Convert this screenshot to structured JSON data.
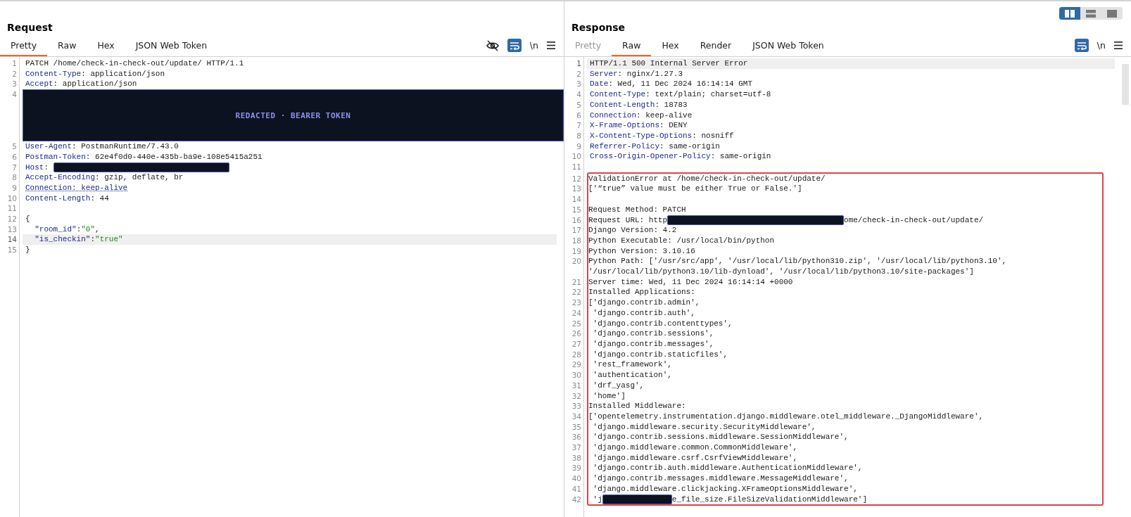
{
  "layout_buttons": [
    {
      "kind": "columns",
      "selected": true
    },
    {
      "kind": "rows",
      "selected": false
    },
    {
      "kind": "single",
      "selected": false
    }
  ],
  "panes": [
    {
      "title": "Request",
      "tabs": [
        {
          "label": "Pretty",
          "selected": true,
          "disabled": false
        },
        {
          "label": "Raw",
          "selected": false,
          "disabled": false
        },
        {
          "label": "Hex",
          "selected": false,
          "disabled": false
        },
        {
          "label": "JSON Web Token",
          "selected": false,
          "disabled": false
        }
      ],
      "tools": [
        {
          "kind": "hide"
        },
        {
          "kind": "wrap",
          "on": true
        },
        {
          "kind": "newline",
          "label": "\\n"
        },
        {
          "kind": "menu"
        }
      ],
      "lines": [
        {
          "number": "1",
          "selected": false,
          "boxed": false,
          "segments": [
            {
              "kind": "text",
              "text": "PATCH /home/check-in-check-out/update/ HTTP/1.1"
            }
          ]
        },
        {
          "number": "2",
          "selected": false,
          "boxed": false,
          "segments": [
            {
              "kind": "key",
              "text": "Content-Type"
            },
            {
              "kind": "text",
              "text": ": application/json"
            }
          ]
        },
        {
          "number": "3",
          "selected": false,
          "boxed": false,
          "segments": [
            {
              "kind": "key",
              "text": "Accept"
            },
            {
              "kind": "text",
              "text": ": application/json"
            }
          ]
        },
        {
          "number": "4",
          "selected": false,
          "boxed": false,
          "segments": [
            {
              "kind": "banner",
              "text": "REDACTED · BEARER TOKEN"
            }
          ]
        },
        {
          "number": "5",
          "selected": false,
          "boxed": false,
          "segments": [
            {
              "kind": "key",
              "text": "User-Agent"
            },
            {
              "kind": "text",
              "text": ": PostmanRuntime/7.43.0"
            }
          ]
        },
        {
          "number": "6",
          "selected": false,
          "boxed": false,
          "segments": [
            {
              "kind": "key",
              "text": "Postman-Token"
            },
            {
              "kind": "text",
              "text": ": 62e4f0d0-440e-435b-ba9e-108e5415a251"
            }
          ]
        },
        {
          "number": "7",
          "selected": false,
          "boxed": false,
          "segments": [
            {
              "kind": "key",
              "text": "Host"
            },
            {
              "kind": "text",
              "text": ": "
            },
            {
              "kind": "redacted_wide"
            }
          ]
        },
        {
          "number": "8",
          "selected": false,
          "boxed": false,
          "segments": [
            {
              "kind": "key",
              "text": "Accept-Encoding"
            },
            {
              "kind": "text",
              "text": ": gzip, deflate, br"
            }
          ]
        },
        {
          "number": "9",
          "selected": false,
          "boxed": false,
          "segments": [
            {
              "kind": "flagged",
              "text": "Connection: keep-alive"
            }
          ]
        },
        {
          "number": "10",
          "selected": false,
          "boxed": false,
          "segments": [
            {
              "kind": "key",
              "text": "Content-Length"
            },
            {
              "kind": "text",
              "text": ": 44"
            }
          ]
        },
        {
          "number": "11",
          "selected": false,
          "boxed": false
        },
        {
          "number": "12",
          "selected": false,
          "boxed": false,
          "segments": [
            {
              "kind": "text",
              "text": "{"
            }
          ]
        },
        {
          "number": "13",
          "selected": false,
          "boxed": false,
          "segments": [
            {
              "kind": "key",
              "text": "  \"room_id\""
            },
            {
              "kind": "text",
              "text": ":"
            },
            {
              "kind": "string",
              "text": "\"0\""
            },
            {
              "kind": "text",
              "text": ","
            }
          ]
        },
        {
          "number": "14",
          "selected": true,
          "boxed": false,
          "segments": [
            {
              "kind": "key",
              "text": "  \"is_checkin\""
            },
            {
              "kind": "text",
              "text": ":"
            },
            {
              "kind": "string",
              "text": "\"true\""
            }
          ]
        },
        {
          "number": "15",
          "selected": false,
          "boxed": false,
          "segments": [
            {
              "kind": "text",
              "text": "}"
            }
          ]
        }
      ]
    },
    {
      "title": "Response",
      "tabs": [
        {
          "label": "Pretty",
          "selected": false,
          "disabled": true
        },
        {
          "label": "Raw",
          "selected": true,
          "disabled": false
        },
        {
          "label": "Hex",
          "selected": false,
          "disabled": false
        },
        {
          "label": "Render",
          "selected": false,
          "disabled": false
        },
        {
          "label": "JSON Web Token",
          "selected": false,
          "disabled": false
        }
      ],
      "tools": [
        {
          "kind": "wrap",
          "on": true
        },
        {
          "kind": "newline",
          "label": "\\n"
        },
        {
          "kind": "menu"
        }
      ],
      "scrollbar": true,
      "lines": [
        {
          "number": "1",
          "selected": true,
          "boxed": false,
          "segments": [
            {
              "kind": "text",
              "text": "HTTP/1.1 500 Internal Server Error"
            }
          ]
        },
        {
          "number": "2",
          "selected": false,
          "boxed": false,
          "segments": [
            {
              "kind": "key",
              "text": "Server"
            },
            {
              "kind": "text",
              "text": ": nginx/1.27.3"
            }
          ]
        },
        {
          "number": "3",
          "selected": false,
          "boxed": false,
          "segments": [
            {
              "kind": "key",
              "text": "Date"
            },
            {
              "kind": "text",
              "text": ": Wed, 11 Dec 2024 16:14:14 GMT"
            }
          ]
        },
        {
          "number": "4",
          "selected": false,
          "boxed": false,
          "segments": [
            {
              "kind": "key",
              "text": "Content-Type"
            },
            {
              "kind": "text",
              "text": ": text/plain; charset=utf-8"
            }
          ]
        },
        {
          "number": "5",
          "selected": false,
          "boxed": false,
          "segments": [
            {
              "kind": "key",
              "text": "Content-Length"
            },
            {
              "kind": "text",
              "text": ": 18783"
            }
          ]
        },
        {
          "number": "6",
          "selected": false,
          "boxed": false,
          "segments": [
            {
              "kind": "key",
              "text": "Connection"
            },
            {
              "kind": "text",
              "text": ": keep-alive"
            }
          ]
        },
        {
          "number": "7",
          "selected": false,
          "boxed": false,
          "segments": [
            {
              "kind": "key",
              "text": "X-Frame-Options"
            },
            {
              "kind": "text",
              "text": ": DENY"
            }
          ]
        },
        {
          "number": "8",
          "selected": false,
          "boxed": false,
          "segments": [
            {
              "kind": "key",
              "text": "X-Content-Type-Options"
            },
            {
              "kind": "text",
              "text": ": nosniff"
            }
          ]
        },
        {
          "number": "9",
          "selected": false,
          "boxed": false,
          "segments": [
            {
              "kind": "key",
              "text": "Referrer-Policy"
            },
            {
              "kind": "text",
              "text": ": same-origin"
            }
          ]
        },
        {
          "number": "10",
          "selected": false,
          "boxed": false,
          "segments": [
            {
              "kind": "key",
              "text": "Cross-Origin-Opener-Policy"
            },
            {
              "kind": "text",
              "text": ": same-origin"
            }
          ]
        },
        {
          "number": "11",
          "selected": false,
          "boxed": false
        },
        {
          "number": "12",
          "selected": false,
          "boxed": true,
          "segments": [
            {
              "kind": "text",
              "text": "ValidationError at /home/check-in-check-out/update/"
            }
          ]
        },
        {
          "number": "13",
          "selected": false,
          "boxed": true,
          "segments": [
            {
              "kind": "text",
              "text": "['“true” value must be either True or False.']"
            }
          ]
        },
        {
          "number": "14",
          "selected": false,
          "boxed": true
        },
        {
          "number": "15",
          "selected": false,
          "boxed": true,
          "segments": [
            {
              "kind": "text",
              "text": "Request Method: PATCH"
            }
          ]
        },
        {
          "number": "16",
          "selected": false,
          "boxed": true,
          "segments": [
            {
              "kind": "text",
              "text": "Request URL: http"
            },
            {
              "kind": "redacted_wide"
            },
            {
              "kind": "text",
              "text": "ome/check-in-check-out/update/"
            }
          ]
        },
        {
          "number": "17",
          "selected": false,
          "boxed": true,
          "segments": [
            {
              "kind": "text",
              "text": "Django Version: 4.2"
            }
          ]
        },
        {
          "number": "18",
          "selected": false,
          "boxed": true,
          "segments": [
            {
              "kind": "text",
              "text": "Python Executable: /usr/local/bin/python"
            }
          ]
        },
        {
          "number": "19",
          "selected": false,
          "boxed": true,
          "segments": [
            {
              "kind": "text",
              "text": "Python Version: 3.10.16"
            }
          ]
        },
        {
          "number": "20",
          "selected": false,
          "boxed": true,
          "segments": [
            {
              "kind": "text",
              "text": "Python Path: ['/usr/src/app', '/usr/local/lib/python310.zip', '/usr/local/lib/python3.10', '/usr/local/lib/python3.10/lib-dynload', '/usr/local/lib/python3.10/site-packages']"
            }
          ]
        },
        {
          "number": "21",
          "selected": false,
          "boxed": true,
          "segments": [
            {
              "kind": "text",
              "text": "Server time: Wed, 11 Dec 2024 16:14:14 +0000"
            }
          ]
        },
        {
          "number": "22",
          "selected": false,
          "boxed": true,
          "segments": [
            {
              "kind": "text",
              "text": "Installed Applications:"
            }
          ]
        },
        {
          "number": "23",
          "selected": false,
          "boxed": true,
          "segments": [
            {
              "kind": "text",
              "text": "['django.contrib.admin',"
            }
          ]
        },
        {
          "number": "24",
          "selected": false,
          "boxed": true,
          "segments": [
            {
              "kind": "text",
              "text": " 'django.contrib.auth',"
            }
          ]
        },
        {
          "number": "25",
          "selected": false,
          "boxed": true,
          "segments": [
            {
              "kind": "text",
              "text": " 'django.contrib.contenttypes',"
            }
          ]
        },
        {
          "number": "26",
          "selected": false,
          "boxed": true,
          "segments": [
            {
              "kind": "text",
              "text": " 'django.contrib.sessions',"
            }
          ]
        },
        {
          "number": "27",
          "selected": false,
          "boxed": true,
          "segments": [
            {
              "kind": "text",
              "text": " 'django.contrib.messages',"
            }
          ]
        },
        {
          "number": "28",
          "selected": false,
          "boxed": true,
          "segments": [
            {
              "kind": "text",
              "text": " 'django.contrib.staticfiles',"
            }
          ]
        },
        {
          "number": "29",
          "selected": false,
          "boxed": true,
          "segments": [
            {
              "kind": "text",
              "text": " 'rest_framework',"
            }
          ]
        },
        {
          "number": "30",
          "selected": false,
          "boxed": true,
          "segments": [
            {
              "kind": "text",
              "text": " 'authentication',"
            }
          ]
        },
        {
          "number": "31",
          "selected": false,
          "boxed": true,
          "segments": [
            {
              "kind": "text",
              "text": " 'drf_yasg',"
            }
          ]
        },
        {
          "number": "32",
          "selected": false,
          "boxed": true,
          "segments": [
            {
              "kind": "text",
              "text": " 'home']"
            }
          ]
        },
        {
          "number": "33",
          "selected": false,
          "boxed": true,
          "segments": [
            {
              "kind": "text",
              "text": "Installed Middleware:"
            }
          ]
        },
        {
          "number": "34",
          "selected": false,
          "boxed": true,
          "segments": [
            {
              "kind": "text",
              "text": "['opentelemetry.instrumentation.django.middleware.otel_middleware._DjangoMiddleware',"
            }
          ]
        },
        {
          "number": "35",
          "selected": false,
          "boxed": true,
          "segments": [
            {
              "kind": "text",
              "text": " 'django.middleware.security.SecurityMiddleware',"
            }
          ]
        },
        {
          "number": "36",
          "selected": false,
          "boxed": true,
          "segments": [
            {
              "kind": "text",
              "text": " 'django.contrib.sessions.middleware.SessionMiddleware',"
            }
          ]
        },
        {
          "number": "37",
          "selected": false,
          "boxed": true,
          "segments": [
            {
              "kind": "text",
              "text": " 'django.middleware.common.CommonMiddleware',"
            }
          ]
        },
        {
          "number": "38",
          "selected": false,
          "boxed": true,
          "segments": [
            {
              "kind": "text",
              "text": " 'django.middleware.csrf.CsrfViewMiddleware',"
            }
          ]
        },
        {
          "number": "39",
          "selected": false,
          "boxed": true,
          "segments": [
            {
              "kind": "text",
              "text": " 'django.contrib.auth.middleware.AuthenticationMiddleware',"
            }
          ]
        },
        {
          "number": "40",
          "selected": false,
          "boxed": true,
          "segments": [
            {
              "kind": "text",
              "text": " 'django.contrib.messages.middleware.MessageMiddleware',"
            }
          ]
        },
        {
          "number": "41",
          "selected": false,
          "boxed": true,
          "segments": [
            {
              "kind": "text",
              "text": " 'django.middleware.clickjacking.XFrameOptionsMiddleware',"
            }
          ]
        },
        {
          "number": "42",
          "selected": false,
          "boxed": true,
          "segments": [
            {
              "kind": "text",
              "text": " 'j"
            },
            {
              "kind": "redacted_narrow"
            },
            {
              "kind": "text",
              "text": "e_file_size.FileSizeValidationMiddleware']"
            }
          ]
        }
      ]
    }
  ]
}
